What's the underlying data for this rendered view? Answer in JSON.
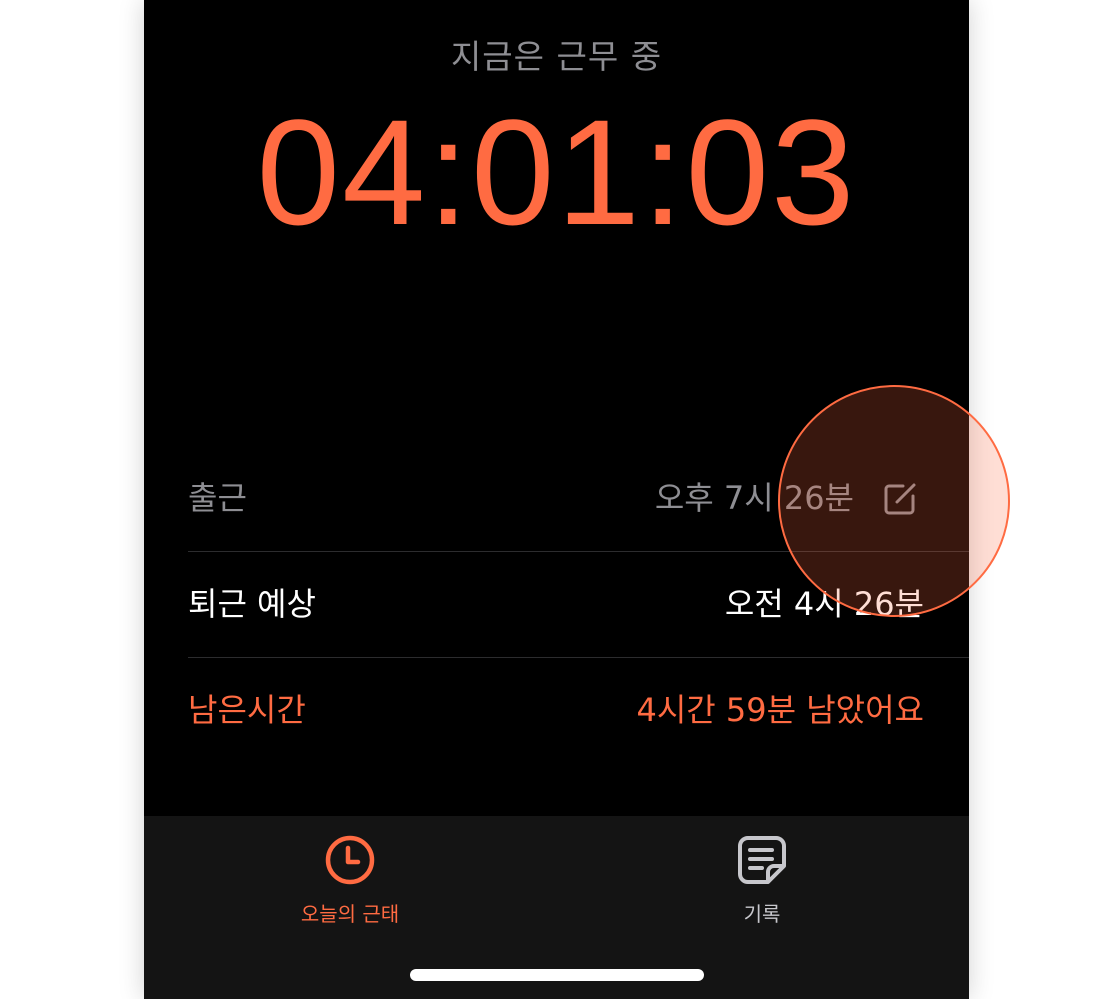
{
  "status": {
    "label": "지금은 근무 중"
  },
  "timer": {
    "elapsed": "04:01:03"
  },
  "rows": [
    {
      "label": "출근",
      "value": "오후 7시 26분"
    },
    {
      "label": "퇴근 예상",
      "value": "오전 4시 26분"
    },
    {
      "label": "남은시간",
      "value": "4시간 59분 남았어요"
    }
  ],
  "tabs": {
    "today": {
      "label": "오늘의 근태",
      "icon": "clock-icon"
    },
    "record": {
      "label": "기록",
      "icon": "document-icon"
    }
  },
  "colors": {
    "accent": "#ff6b42",
    "background": "#000000",
    "muted": "#8e8e93",
    "tabbar": "#141414"
  }
}
